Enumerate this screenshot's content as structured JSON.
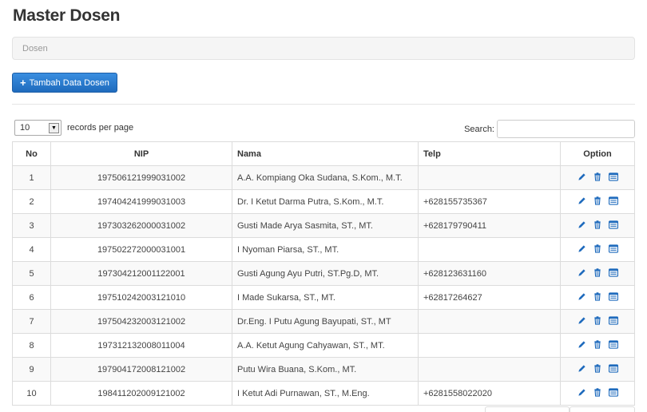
{
  "page": {
    "title": "Master Dosen"
  },
  "breadcrumb": {
    "current": "Dosen"
  },
  "actions": {
    "add_label": "Tambah Data Dosen"
  },
  "table_controls": {
    "length_value": "10",
    "length_suffix": "records per page",
    "search_label": "Search:"
  },
  "table": {
    "headers": {
      "no": "No",
      "nip": "NIP",
      "nama": "Nama",
      "telp": "Telp",
      "option": "Option"
    },
    "rows": [
      {
        "no": "1",
        "nip": "197506121999031002",
        "nama": "A.A. Kompiang Oka Sudana, S.Kom., M.T.",
        "telp": ""
      },
      {
        "no": "2",
        "nip": "197404241999031003",
        "nama": "Dr. I Ketut Darma Putra, S.Kom., M.T.",
        "telp": "+628155735367"
      },
      {
        "no": "3",
        "nip": "197303262000031002",
        "nama": "Gusti Made Arya Sasmita, ST., MT.",
        "telp": "+628179790411"
      },
      {
        "no": "4",
        "nip": "197502272000031001",
        "nama": "I Nyoman Piarsa, ST., MT.",
        "telp": ""
      },
      {
        "no": "5",
        "nip": "197304212001122001",
        "nama": "Gusti Agung Ayu Putri, ST.Pg.D, MT.",
        "telp": "+628123631160"
      },
      {
        "no": "6",
        "nip": "197510242003121010",
        "nama": "I Made Sukarsa, ST., MT.",
        "telp": "+62817264627"
      },
      {
        "no": "7",
        "nip": "197504232003121002",
        "nama": "Dr.Eng. I Putu Agung Bayupati, ST., MT",
        "telp": ""
      },
      {
        "no": "8",
        "nip": "197312132008011004",
        "nama": "A.A. Ketut Agung Cahyawan, ST., MT.",
        "telp": ""
      },
      {
        "no": "9",
        "nip": "197904172008121002",
        "nama": "Putu Wira Buana, S.Kom., MT.",
        "telp": ""
      },
      {
        "no": "10",
        "nip": "198411202009121002",
        "nama": "I Ketut Adi Purnawan, ST., M.Eng.",
        "telp": "+6281558022020"
      }
    ],
    "option_icons": [
      "pencil-icon",
      "trash-icon",
      "detail-card-icon"
    ]
  },
  "colors": {
    "primary": "#2a78cc",
    "icon_blue": "#1f6bbd",
    "stripe": "#f9f9f9"
  }
}
